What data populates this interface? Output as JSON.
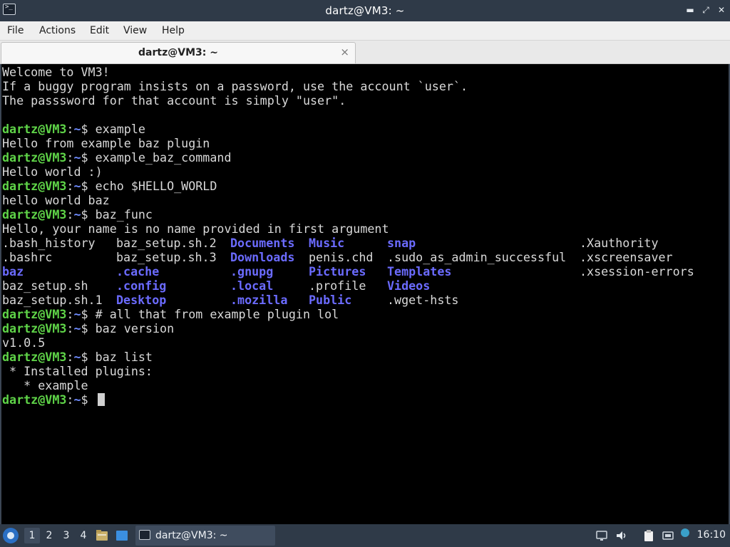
{
  "window": {
    "title": "dartz@VM3: ~"
  },
  "menu": [
    "File",
    "Actions",
    "Edit",
    "View",
    "Help"
  ],
  "tab": {
    "label": "dartz@VM3: ~",
    "close": "×"
  },
  "prompt": {
    "user_host": "dartz@VM3",
    "colon": ":",
    "path": "~",
    "symbol": "$"
  },
  "terminal": {
    "lines": [
      {
        "kind": "out",
        "text": "Welcome to VM3!"
      },
      {
        "kind": "out",
        "text": "If a buggy program insists on a password, use the account `user`."
      },
      {
        "kind": "out",
        "text": "The passsword for that account is simply \"user\"."
      },
      {
        "kind": "out",
        "text": ""
      },
      {
        "kind": "cmd",
        "text": " example"
      },
      {
        "kind": "out",
        "text": "Hello from example baz plugin"
      },
      {
        "kind": "cmd",
        "text": " example_baz_command"
      },
      {
        "kind": "out",
        "text": "Hello world :)"
      },
      {
        "kind": "cmd",
        "text": " echo $HELLO_WORLD"
      },
      {
        "kind": "out",
        "text": "hello world baz"
      },
      {
        "kind": "cmd",
        "text": " baz_func"
      },
      {
        "kind": "out",
        "text": "Hello, your name is no name provided in first argument"
      },
      {
        "kind": "ls",
        "cells": [
          {
            "t": ".bash_history",
            "d": false
          },
          {
            "t": "baz_setup.sh.2",
            "d": false
          },
          {
            "t": "Documents",
            "d": true
          },
          {
            "t": "Music",
            "d": true
          },
          {
            "t": "snap",
            "d": true
          },
          {
            "t": "",
            "d": false
          },
          {
            "t": ".Xauthority",
            "d": false
          }
        ]
      },
      {
        "kind": "ls",
        "cells": [
          {
            "t": ".bashrc",
            "d": false
          },
          {
            "t": "baz_setup.sh.3",
            "d": false
          },
          {
            "t": "Downloads",
            "d": true
          },
          {
            "t": "penis.chd",
            "d": false
          },
          {
            "t": ".sudo_as_admin_successful",
            "d": false
          },
          {
            "t": "",
            "d": false
          },
          {
            "t": ".xscreensaver",
            "d": false
          }
        ]
      },
      {
        "kind": "ls",
        "cells": [
          {
            "t": "baz",
            "d": true
          },
          {
            "t": ".cache",
            "d": true
          },
          {
            "t": ".gnupg",
            "d": true
          },
          {
            "t": "Pictures",
            "d": true
          },
          {
            "t": "Templates",
            "d": true
          },
          {
            "t": "",
            "d": false
          },
          {
            "t": ".xsession-errors",
            "d": false
          }
        ]
      },
      {
        "kind": "ls",
        "cells": [
          {
            "t": "baz_setup.sh",
            "d": false
          },
          {
            "t": ".config",
            "d": true
          },
          {
            "t": ".local",
            "d": true
          },
          {
            "t": ".profile",
            "d": false
          },
          {
            "t": "Videos",
            "d": true
          },
          {
            "t": "",
            "d": false
          },
          {
            "t": "",
            "d": false
          }
        ]
      },
      {
        "kind": "ls",
        "cells": [
          {
            "t": "baz_setup.sh.1",
            "d": false
          },
          {
            "t": "Desktop",
            "d": true
          },
          {
            "t": ".mozilla",
            "d": true
          },
          {
            "t": "Public",
            "d": true
          },
          {
            "t": ".wget-hsts",
            "d": false
          },
          {
            "t": "",
            "d": false
          },
          {
            "t": "",
            "d": false
          }
        ]
      },
      {
        "kind": "cmd",
        "text": " # all that from example plugin lol"
      },
      {
        "kind": "cmd",
        "text": " baz version"
      },
      {
        "kind": "out",
        "text": "v1.0.5"
      },
      {
        "kind": "cmd",
        "text": " baz list"
      },
      {
        "kind": "out",
        "text": " * Installed plugins:"
      },
      {
        "kind": "out",
        "text": "   * example"
      },
      {
        "kind": "cmd",
        "text": " ",
        "cursor": true
      }
    ]
  },
  "taskbar": {
    "workspaces": [
      "1",
      "2",
      "3",
      "4"
    ],
    "active_workspace": "1",
    "task_label": "dartz@VM3: ~",
    "clock": "16:10",
    "icons": [
      "start-menu-icon",
      "file-manager-icon",
      "show-desktop-icon",
      "terminal-icon",
      "display-icon",
      "volume-icon",
      "clipboard-icon",
      "network-icon"
    ]
  },
  "colors": {
    "prompt_green": "#5fd448",
    "path_blue": "#6f8cff",
    "dir_blue": "#6b6bff",
    "titlebar": "#2f3a48"
  }
}
